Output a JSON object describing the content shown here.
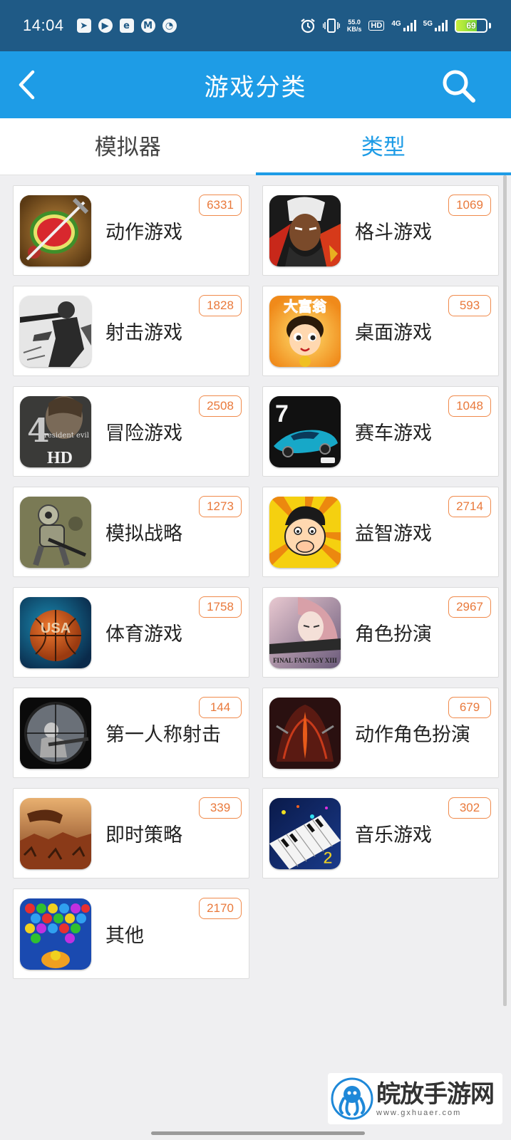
{
  "status_bar": {
    "time": "14:04",
    "net_speed_value": "55.0",
    "net_speed_unit": "KB/s",
    "hd_label": "HD",
    "sim1_label": "4G",
    "sim2_label": "5G",
    "battery_level": "69",
    "battery_percent": 69,
    "left_icons": [
      "navigation-app-icon",
      "video-app-icon",
      "tile-app-icon",
      "circle-app-icon",
      "gauge-app-icon"
    ],
    "right_icons": [
      "alarm-icon",
      "vibrate-icon",
      "hd-icon",
      "signal-icon",
      "battery-icon"
    ]
  },
  "header": {
    "title": "游戏分类",
    "back_icon": "chevron-left-icon",
    "search_icon": "search-icon"
  },
  "tabs": [
    {
      "label": "模拟器",
      "active": false
    },
    {
      "label": "类型",
      "active": true
    }
  ],
  "categories": [
    {
      "label": "动作游戏",
      "count": "6331"
    },
    {
      "label": "格斗游戏",
      "count": "1069"
    },
    {
      "label": "射击游戏",
      "count": "1828"
    },
    {
      "label": "桌面游戏",
      "count": "593"
    },
    {
      "label": "冒险游戏",
      "count": "2508"
    },
    {
      "label": "赛车游戏",
      "count": "1048"
    },
    {
      "label": "模拟战略",
      "count": "1273"
    },
    {
      "label": "益智游戏",
      "count": "2714"
    },
    {
      "label": "体育游戏",
      "count": "1758"
    },
    {
      "label": "角色扮演",
      "count": "2967"
    },
    {
      "label": "第一人称射击",
      "count": "144"
    },
    {
      "label": "动作角色扮演",
      "count": "679"
    },
    {
      "label": "即时策略",
      "count": "339"
    },
    {
      "label": "音乐游戏",
      "count": "302"
    },
    {
      "label": "其他",
      "count": "2170"
    }
  ],
  "thumb_texts": {
    "board": "大富翁",
    "re4_num": "4",
    "re4_title": "resident evil",
    "re4_hd": "HD",
    "race_num": "7",
    "sport": "USA",
    "ff": "FINAL FANTASY XIII",
    "music_num": "2"
  },
  "watermark": {
    "name": "皖放手游网",
    "url": "www.gxhuaer.com"
  },
  "colors": {
    "status_bar": "#1f5a86",
    "header": "#1e9ce6",
    "accent": "#1e9ce6",
    "badge": "#e9793b",
    "background": "#efeff1"
  }
}
